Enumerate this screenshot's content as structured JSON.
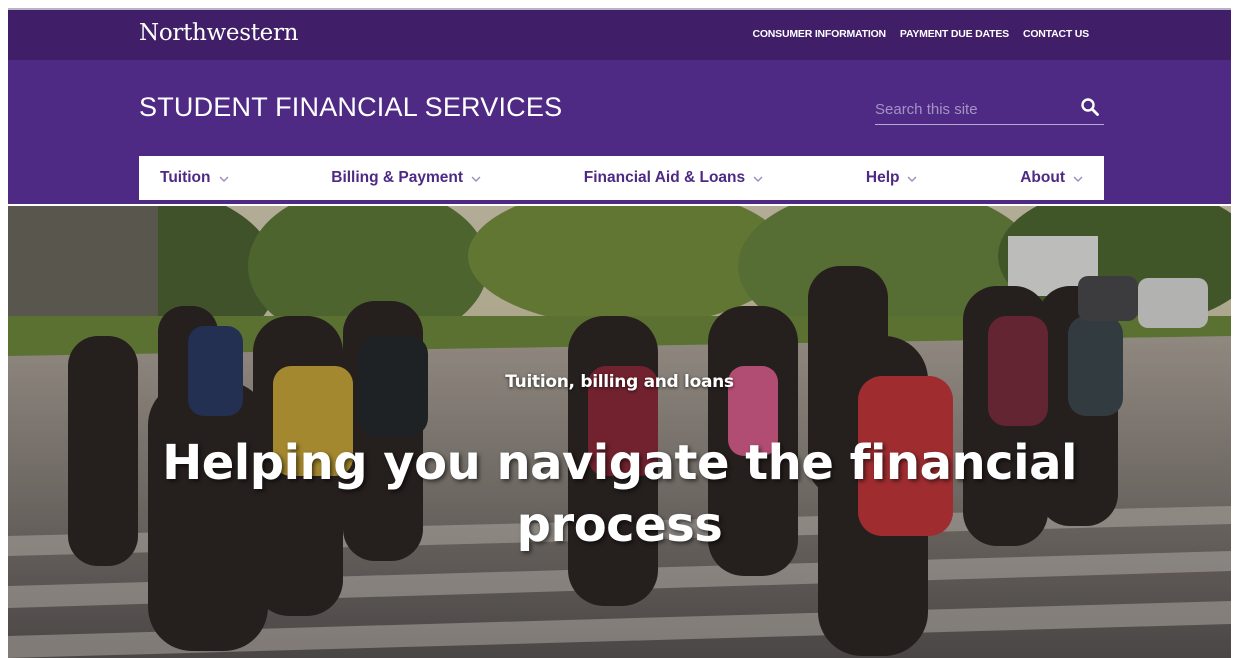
{
  "topbar": {
    "logo": "Northwestern",
    "links": [
      "CONSUMER INFORMATION",
      "PAYMENT DUE DATES",
      "CONTACT US"
    ]
  },
  "header": {
    "site_title": "STUDENT FINANCIAL SERVICES",
    "search": {
      "placeholder": "Search this site",
      "value": "",
      "icon": "search-icon"
    }
  },
  "nav": {
    "items": [
      {
        "label": "Tuition",
        "icon": "chevron-down-icon"
      },
      {
        "label": "Billing & Payment",
        "icon": "chevron-down-icon"
      },
      {
        "label": "Financial Aid & Loans",
        "icon": "chevron-down-icon"
      },
      {
        "label": "Help",
        "icon": "chevron-down-icon"
      },
      {
        "label": "About",
        "icon": "chevron-down-icon"
      }
    ]
  },
  "hero": {
    "eyebrow": "Tuition, billing and loans",
    "headline": "Helping you navigate the financial process"
  },
  "colors": {
    "topbar": "#401f68",
    "header": "#4e2a84",
    "nav_text": "#4e2a84",
    "white": "#ffffff"
  }
}
